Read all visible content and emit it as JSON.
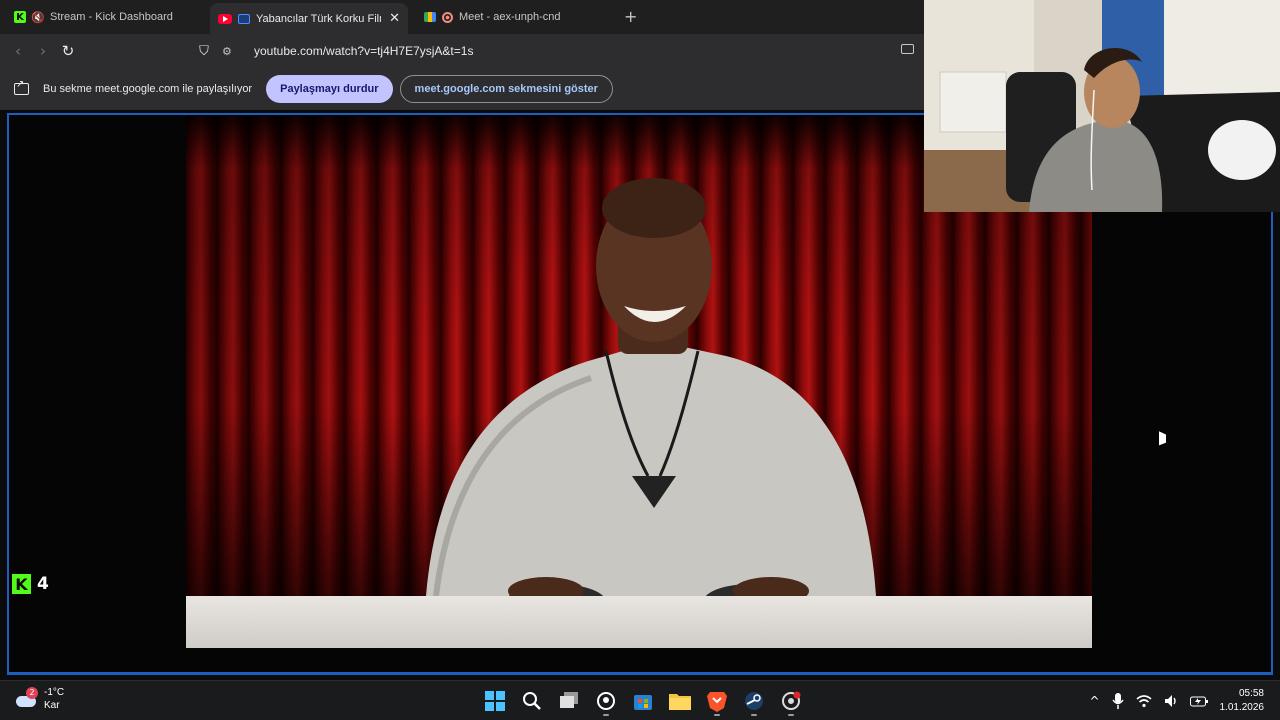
{
  "browser": {
    "tabs": [
      {
        "title": "Stream - Kick Dashboard",
        "favicon": "kick-logo-icon",
        "muted": true,
        "active": false
      },
      {
        "title": "Yabancılar Türk Korku Filmleri",
        "favicon": "youtube-icon",
        "casting": true,
        "active": true,
        "close_glyph": "✕"
      },
      {
        "title": "Meet - aex-unph-cnd",
        "favicon": "google-meet-icon",
        "recording": true,
        "active": false
      }
    ],
    "new_tab_glyph": "+",
    "nav": {
      "back": "‹",
      "forward": "›",
      "reload": "↻",
      "bookmark": "⛉"
    },
    "url": "youtube.com/watch?v=tj4H7E7ysjA&t=1s"
  },
  "share_bar": {
    "message": "Bu sekme meet.google.com ile paylaşılıyor",
    "stop_button": "Paylaşmayı durdur",
    "show_tab_button": "meet.google.com sekmesini göster"
  },
  "kick_overlay": {
    "logo": "K",
    "viewer_count": "4"
  },
  "colors": {
    "accent_blue": "#1c5fbf",
    "kick_green": "#53fc18",
    "stop_pill": "#c2c3ff"
  },
  "taskbar": {
    "weather": {
      "temp": "-1°C",
      "condition": "Kar",
      "badge": "2"
    },
    "apps": [
      "windows-start-icon",
      "search-icon",
      "task-view-icon",
      "copilot-icon",
      "microsoft-store-icon",
      "file-explorer-icon",
      "brave-browser-icon",
      "steam-icon",
      "chrome-icon"
    ],
    "tray": {
      "chevron": "^",
      "time": "05:58",
      "date": "1.01.2026"
    }
  }
}
